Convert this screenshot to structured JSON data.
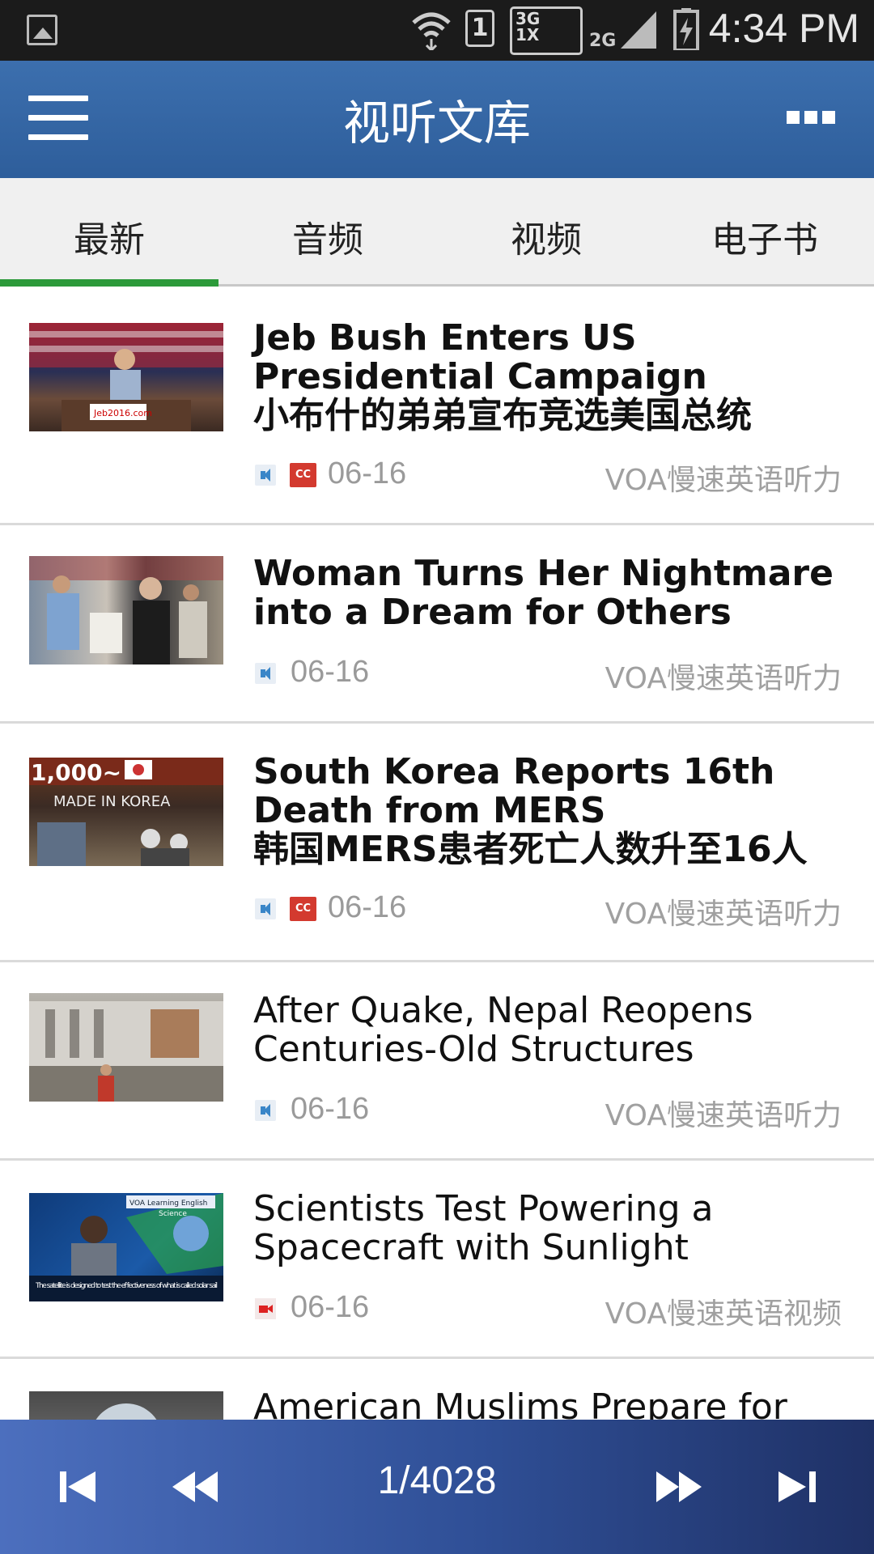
{
  "status_bar": {
    "time": "4:34 PM",
    "net_3g": "3G",
    "net_1x": "1X",
    "net_2g": "2G",
    "sim": "1"
  },
  "app_bar": {
    "title": "视听文库"
  },
  "tabs": [
    {
      "label": "最新",
      "active": true
    },
    {
      "label": "音频",
      "active": false
    },
    {
      "label": "视频",
      "active": false
    },
    {
      "label": "电子书",
      "active": false
    }
  ],
  "items": [
    {
      "title_en": "Jeb Bush Enters US Presidential Campaign",
      "title_zh": "小布什的弟弟宣布竞选美国总统",
      "date": "06-16",
      "source": "VOA慢速英语听力",
      "media": "audio",
      "cc": "CC",
      "bold": true
    },
    {
      "title_en": "Woman Turns Her Nightmare into a Dream for Others",
      "title_zh": "",
      "date": "06-16",
      "source": "VOA慢速英语听力",
      "media": "audio",
      "cc": "",
      "bold": true
    },
    {
      "title_en": "South Korea Reports 16th Death from MERS",
      "title_zh": "韩国MERS患者死亡人数升至16人",
      "date": "06-16",
      "source": "VOA慢速英语听力",
      "media": "audio",
      "cc": "CC",
      "bold": true
    },
    {
      "title_en": "After Quake, Nepal Reopens Centuries-Old Structures",
      "title_zh": "",
      "date": "06-16",
      "source": "VOA慢速英语听力",
      "media": "audio",
      "cc": "",
      "bold": false
    },
    {
      "title_en": "Scientists Test Powering a Spacecraft with Sunlight",
      "title_zh": "",
      "date": "06-16",
      "source": "VOA慢速英语视频",
      "media": "video",
      "cc": "",
      "bold": false
    },
    {
      "title_en": "American Muslims Prepare for",
      "title_zh": "",
      "date": "",
      "source": "",
      "media": "audio",
      "cc": "",
      "bold": false
    }
  ],
  "thumb_texts": {
    "jeb_sign": "Jeb2016.com",
    "korea_price": "1,000~",
    "korea_sign": "MADE IN KOREA",
    "news_caption": "The satellite is designed to test the effectiveness of what is called solar sail",
    "news_logo": "VOA Learning English",
    "news_tag": "Science"
  },
  "player": {
    "page": "1/4028"
  },
  "colors": {
    "app_bar": "#2e5e9b",
    "tab_indicator": "#2c9a3a",
    "cc_badge": "#d33a2f"
  }
}
